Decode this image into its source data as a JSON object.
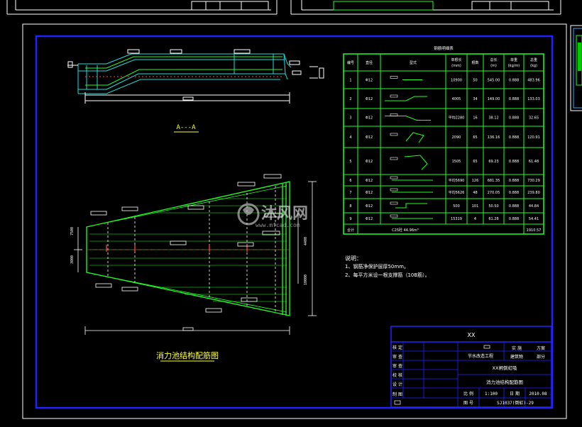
{
  "drawing": {
    "section_label": "A---A",
    "plan_title": "消力池结构配筋图",
    "watermark": {
      "brand": "沐风网",
      "url": "www.mfcad.com"
    }
  },
  "rebar_table": {
    "title": "钢筋明细表",
    "headers": [
      "编号",
      "直径",
      "型式",
      "单根长\n(mm)",
      "根数",
      "总长\n(m)",
      "单重\n(kg/m)",
      "总重\n(kg)"
    ],
    "rows": [
      [
        "1",
        "Φ12",
        "",
        "10900",
        "50",
        "545.00",
        "0.888",
        "483.96"
      ],
      [
        "2",
        "Φ12",
        "",
        "4005",
        "34",
        "149.00",
        "0.888",
        "133.03"
      ],
      [
        "3",
        "Φ12",
        "",
        "平均2280",
        "16",
        "38.12",
        "0.888",
        "32.65"
      ],
      [
        "4",
        "Φ12",
        "",
        "2090",
        "65",
        "136.16",
        "0.888",
        "120.91"
      ],
      [
        "5",
        "Φ12",
        "",
        "1505",
        "65",
        "69.23",
        "0.888",
        "61.48"
      ],
      [
        "6",
        "Φ12",
        "",
        "平均5690",
        "126",
        "681.35",
        "0.888",
        "730.29"
      ],
      [
        "7",
        "Φ12",
        "",
        "平均5626",
        "48",
        "270.05",
        "0.888",
        "239.80"
      ],
      [
        "8",
        "Φ12",
        "",
        "500",
        "101",
        "50.50",
        "0.888",
        "44.84"
      ],
      [
        "9",
        "Φ12",
        "",
        "15319",
        "4",
        "61.28",
        "0.888",
        "54.41"
      ]
    ],
    "total_label": "合计",
    "total_note": "C25砼 44.96m³",
    "total_value": "1910.57"
  },
  "notes": {
    "heading": "说明：",
    "lines": [
      "1、钢筋净保护层厚50mm。",
      "2、每平方米设一根支撑筋（10B筋）。"
    ]
  },
  "title_block": {
    "company": "XX",
    "roles": [
      "核 定",
      "审 查",
      "审 查",
      "校 核",
      "设 计",
      "制 图"
    ],
    "project_line": "节水改造工程",
    "stage_left": "实 施",
    "stage_right": "方案",
    "category_left": "建筑物",
    "category_right": "部分",
    "subproject": "XX闸倒虹吸",
    "drawing_name": "消力池结构配筋图",
    "scale_label": "比 例",
    "scale_value": "1:100",
    "date_label": "日 期",
    "date_value": "2010.08",
    "no_label": "图 号",
    "no_value": "SJ1037(倒虹)-29"
  },
  "dimensions": {
    "left_1": "7500",
    "left_2": "3000",
    "right_1": "4400",
    "right_2": "10000"
  }
}
